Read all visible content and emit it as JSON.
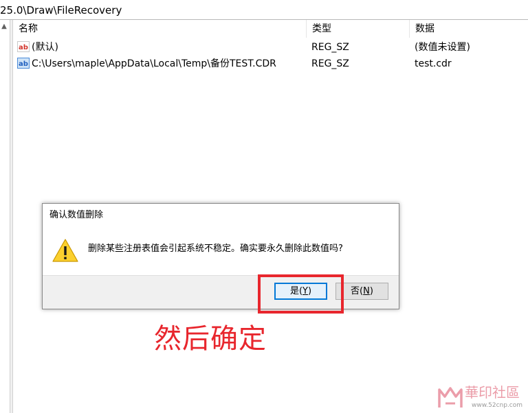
{
  "address": {
    "path": "25.0\\Draw\\FileRecovery"
  },
  "tree": {
    "scroll_up_glyph": "▲"
  },
  "list": {
    "columns": {
      "name": "名称",
      "type": "类型",
      "data": "数据"
    },
    "rows": [
      {
        "name": "(默认)",
        "type": "REG_SZ",
        "data": "(数值未设置)",
        "icon": "string-value-icon"
      },
      {
        "name": "C:\\Users\\maple\\AppData\\Local\\Temp\\备份TEST.CDR",
        "type": "REG_SZ",
        "data": "test.cdr",
        "icon": "string-value-icon"
      }
    ]
  },
  "dialog": {
    "title": "确认数值删除",
    "message": "删除某些注册表值会引起系统不稳定。确实要永久删除此数值吗?",
    "icon": "warning-icon",
    "yes_prefix": "是(",
    "yes_key": "Y",
    "yes_suffix": ")",
    "no_prefix": "否(",
    "no_key": "N",
    "no_suffix": ")"
  },
  "annotation": {
    "text": "然后确定",
    "color": "#e8262d"
  },
  "watermark": {
    "site_name": "華印社區",
    "url": "www.52cnp.com"
  }
}
